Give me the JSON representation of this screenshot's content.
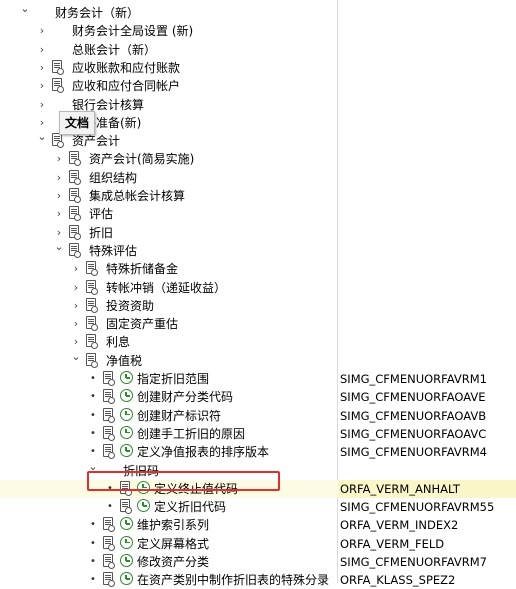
{
  "tooltip": "文档",
  "rows": [
    {
      "label": "财务会计（新）",
      "level": 0,
      "arrow": "down",
      "doc": false,
      "clock": false,
      "code": ""
    },
    {
      "label": "财务会计全局设置 (新)",
      "level": 1,
      "arrow": "right",
      "doc": false,
      "clock": false,
      "code": ""
    },
    {
      "label": "总账会计（新）",
      "level": 1,
      "arrow": "right",
      "doc": false,
      "clock": false,
      "code": ""
    },
    {
      "label": "应收账款和应付账款",
      "level": 1,
      "arrow": "right",
      "doc": true,
      "clock": false,
      "code": ""
    },
    {
      "label": "应收和应付合同帐户",
      "level": 1,
      "arrow": "right",
      "doc": true,
      "clock": false,
      "code": ""
    },
    {
      "label": "银行会计核算",
      "level": 1,
      "arrow": "right",
      "doc": false,
      "clock": false,
      "code": ""
    },
    {
      "label": "合并准备(新)",
      "level": 1,
      "arrow": "right",
      "doc": false,
      "clock": false,
      "code": ""
    },
    {
      "label": "资产会计",
      "level": 1,
      "arrow": "down",
      "doc": true,
      "clock": false,
      "code": ""
    },
    {
      "label": "资产会计(简易实施)",
      "level": 2,
      "arrow": "right",
      "doc": true,
      "clock": false,
      "code": ""
    },
    {
      "label": "组织结构",
      "level": 2,
      "arrow": "right",
      "doc": true,
      "clock": false,
      "code": ""
    },
    {
      "label": "集成总帐会计核算",
      "level": 2,
      "arrow": "right",
      "doc": true,
      "clock": false,
      "code": ""
    },
    {
      "label": "评估",
      "level": 2,
      "arrow": "right",
      "doc": true,
      "clock": false,
      "code": ""
    },
    {
      "label": "折旧",
      "level": 2,
      "arrow": "right",
      "doc": true,
      "clock": false,
      "code": ""
    },
    {
      "label": "特殊评估",
      "level": 2,
      "arrow": "down",
      "doc": true,
      "clock": false,
      "code": ""
    },
    {
      "label": "特殊折储备金",
      "level": 3,
      "arrow": "right",
      "doc": true,
      "clock": false,
      "code": ""
    },
    {
      "label": "转帐冲销（递延收益）",
      "level": 3,
      "arrow": "right",
      "doc": true,
      "clock": false,
      "code": ""
    },
    {
      "label": "投资资助",
      "level": 3,
      "arrow": "right",
      "doc": true,
      "clock": false,
      "code": ""
    },
    {
      "label": "固定资产重估",
      "level": 3,
      "arrow": "right",
      "doc": true,
      "clock": false,
      "code": ""
    },
    {
      "label": "利息",
      "level": 3,
      "arrow": "right",
      "doc": true,
      "clock": false,
      "code": ""
    },
    {
      "label": "净值税",
      "level": 3,
      "arrow": "down",
      "doc": true,
      "clock": false,
      "code": ""
    },
    {
      "label": "指定折旧范围",
      "level": 4,
      "arrow": "dot",
      "doc": true,
      "clock": true,
      "code": "SIMG_CFMENUORFAVRM1"
    },
    {
      "label": "创建财产分类代码",
      "level": 4,
      "arrow": "dot",
      "doc": true,
      "clock": true,
      "code": "SIMG_CFMENUORFAOAVE"
    },
    {
      "label": "创建财产标识符",
      "level": 4,
      "arrow": "dot",
      "doc": true,
      "clock": true,
      "code": "SIMG_CFMENUORFAOAVB"
    },
    {
      "label": "创建手工折旧的原因",
      "level": 4,
      "arrow": "dot",
      "doc": true,
      "clock": true,
      "code": "SIMG_CFMENUORFAOAVC"
    },
    {
      "label": "定义净值报表的排序版本",
      "level": 4,
      "arrow": "dot",
      "doc": true,
      "clock": true,
      "code": "SIMG_CFMENUORFAVRM4"
    },
    {
      "label": "折旧码",
      "level": 4,
      "arrow": "down",
      "doc": false,
      "clock": false,
      "code": ""
    },
    {
      "label": "定义终止值代码",
      "level": 5,
      "arrow": "dot",
      "doc": true,
      "clock": true,
      "code": "ORFA_VERM_ANHALT",
      "selected": true
    },
    {
      "label": "定义折旧代码",
      "level": 5,
      "arrow": "dot",
      "doc": true,
      "clock": true,
      "code": "SIMG_CFMENUORFAVRM55"
    },
    {
      "label": "维护索引系列",
      "level": 4,
      "arrow": "dot",
      "doc": true,
      "clock": true,
      "code": "ORFA_VERM_INDEX2"
    },
    {
      "label": "定义屏幕格式",
      "level": 4,
      "arrow": "dot",
      "doc": true,
      "clock": true,
      "code": "ORFA_VERM_FELD"
    },
    {
      "label": "修改资产分类",
      "level": 4,
      "arrow": "dot",
      "doc": true,
      "clock": true,
      "code": "SIMG_CFMENUORFAVRM7"
    },
    {
      "label": "在资产类别中制作折旧表的特殊分录",
      "level": 4,
      "arrow": "dot",
      "doc": true,
      "clock": true,
      "code": "ORFA_KLASS_SPEZ2"
    }
  ]
}
